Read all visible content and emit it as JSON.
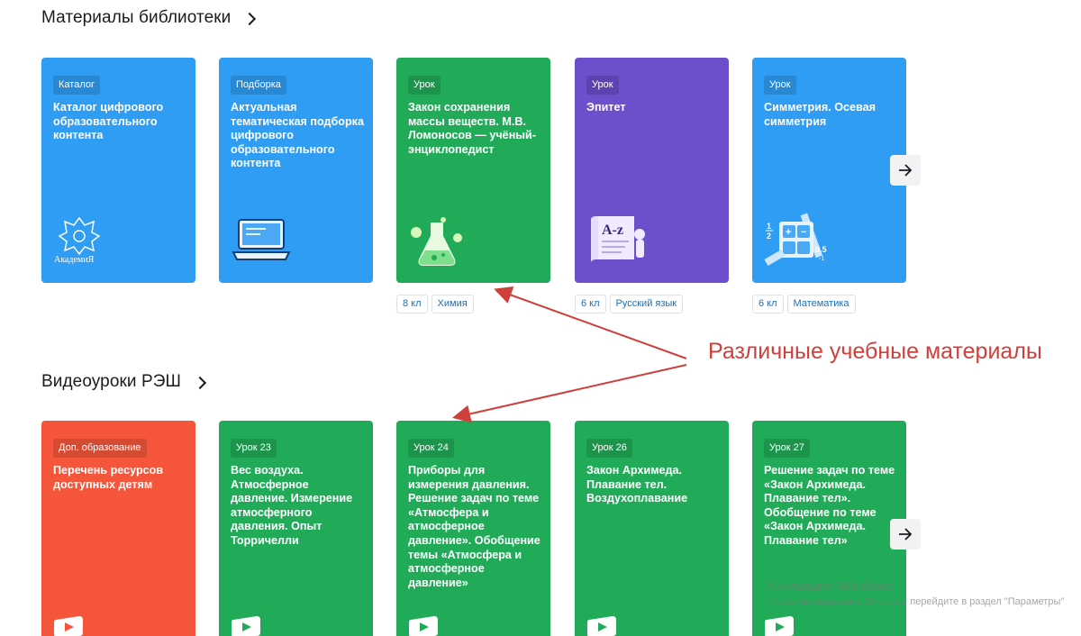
{
  "library": {
    "title": "Материалы библиотеки",
    "cards": [
      {
        "badge": "Каталог",
        "title": "Каталог цифрового образовательного контента",
        "color": "#2e9df3",
        "icon": "academy-logo-icon",
        "logo_text": "АкадемиЯ"
      },
      {
        "badge": "Подборка",
        "title": "Актуальная тематическая подборка цифрового образовательного контента",
        "color": "#2e9df3",
        "icon": "laptop-icon"
      },
      {
        "badge": "Урок",
        "title": "Закон сохранения массы веществ. М.В. Ломоносов — учёный-энциклопедист",
        "color": "#21ab58",
        "icon": "flask-icon",
        "tags": [
          "8 кл",
          "Химия"
        ]
      },
      {
        "badge": "Урок",
        "title": "Эпитет",
        "color": "#6d4ecb",
        "icon": "dictionary-az-icon",
        "tags": [
          "6 кл",
          "Русский язык"
        ]
      },
      {
        "badge": "Урок",
        "title": "Симметрия. Осевая симметрия",
        "color": "#2e9df3",
        "icon": "math-calculator-icon",
        "tags": [
          "6 кл",
          "Математика"
        ]
      }
    ]
  },
  "videos": {
    "title": "Видеоуроки РЭШ",
    "cards": [
      {
        "badge": "Доп. образование",
        "title": "Перечень ресурсов доступных детям",
        "color": "#f5553a"
      },
      {
        "badge": "Урок 23",
        "title": "Вес воздуха. Атмосферное давление. Измерение атмосферного давления. Опыт Торричелли",
        "color": "#21ab58"
      },
      {
        "badge": "Урок 24",
        "title": "Приборы для измерения давления. Решение задач по теме «Атмосфера и атмосферное давление». Обобщение темы «Атмосфера и атмосферное давление»",
        "color": "#21ab58"
      },
      {
        "badge": "Урок 26",
        "title": "Закон Архимеда. Плавание тел. Воздухоплавание",
        "color": "#21ab58"
      },
      {
        "badge": "Урок 27",
        "title": "Решение задач по теме «Закон Архимеда. Плавание тел». Обобщение по теме «Закон Архимеда. Плавание тел»",
        "color": "#21ab58"
      }
    ]
  },
  "annotation": {
    "text": "Различные учебные материалы",
    "color": "#cf3f3b"
  },
  "watermark": {
    "title": "Активация Windows",
    "subtitle": "Чтобы активировать Windows, перейдите в раздел \"Параметры\""
  }
}
